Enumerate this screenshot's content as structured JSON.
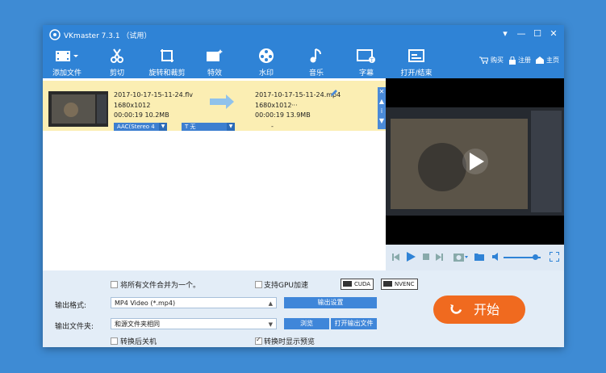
{
  "window": {
    "title": "VKmaster 7.3.1 （试用）"
  },
  "controls": {
    "menu": "▾",
    "minimize": "—",
    "maximize": "☐",
    "close": "✕"
  },
  "toolbar": {
    "add": "添加文件",
    "cut": "剪切",
    "rotate": "旋转和裁剪",
    "effects": "特效",
    "watermark": "水印",
    "music": "音乐",
    "subtitle": "字幕",
    "openclose": "打开/结束",
    "buy": "购买",
    "register": "注册",
    "home": "主页"
  },
  "file": {
    "src_name": "2017-10-17-15-11-24.flv",
    "src_res": "1680x1012",
    "src_meta": "00:00:19  10.2MB",
    "dst_name": "2017-10-17-15-11-24.mp4",
    "dst_res": "1680x1012",
    "dst_res_extra": "···",
    "dst_meta": "00:00:19  13.9MB",
    "audio": "AAC(Stereo 4",
    "subtitle": "T 无",
    "dash": "-"
  },
  "bottom": {
    "merge": "将所有文件合并为一个。",
    "gpu": "支持GPU加速",
    "cuda": "CUDA",
    "nvenc": "NVENC",
    "format_label": "输出格式:",
    "format_value": "MP4 Video (*.mp4)",
    "output_settings": "输出设置",
    "folder_label": "输出文件夹:",
    "folder_value": "和源文件夹相同",
    "browse": "浏览",
    "open_folder": "打开输出文件",
    "shutdown": "转换后关机",
    "preview": "转换时显示预览",
    "start": "开始"
  }
}
